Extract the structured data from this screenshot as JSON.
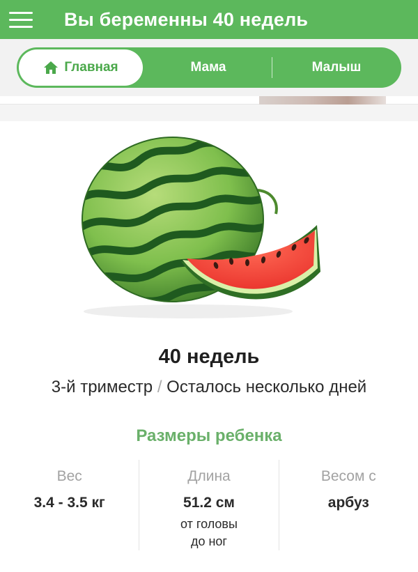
{
  "header": {
    "title": "Вы беременны 40 недель"
  },
  "tabs": [
    {
      "label": "Главная",
      "icon": "home-icon",
      "active": true
    },
    {
      "label": "Мама",
      "active": false
    },
    {
      "label": "Малыш",
      "active": false
    }
  ],
  "hero": {
    "image": "watermelon"
  },
  "week": {
    "title": "40 недель",
    "trimester": "3-й триместр",
    "separator": "/",
    "remaining": "Осталось несколько дней"
  },
  "sizes": {
    "title": "Размеры ребенка",
    "weight": {
      "label": "Вес",
      "value": "3.4 - 3.5 кг"
    },
    "length": {
      "label": "Длина",
      "value": "51.2 см",
      "note_line1": "от головы",
      "note_line2": "до ног"
    },
    "compare": {
      "label": "Весом с",
      "value": "арбуз"
    }
  },
  "colors": {
    "accent": "#5cb85c",
    "accent_text": "#6ab06a"
  }
}
